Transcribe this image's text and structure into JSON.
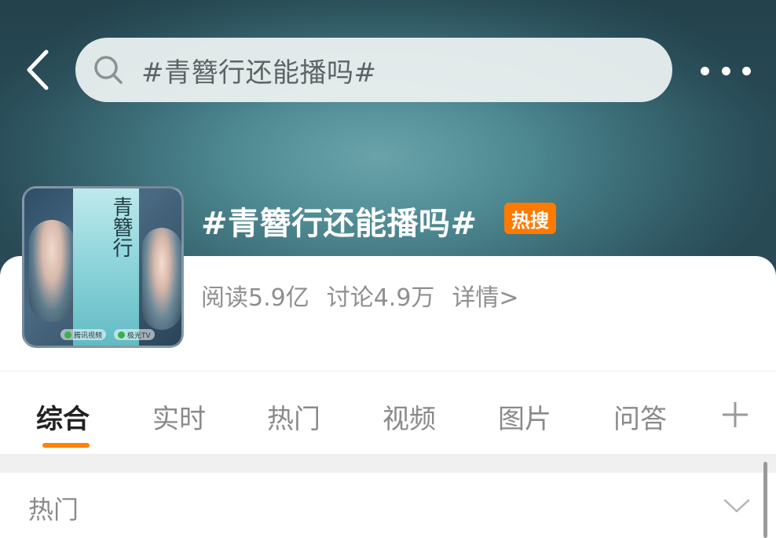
{
  "search": {
    "query": "#青簪行还能播吗#"
  },
  "topic": {
    "title": "#青簪行还能播吗#",
    "badge": "热搜",
    "stats": {
      "read": "阅读5.9亿",
      "discuss": "讨论4.9万",
      "details": "详情>"
    },
    "poster": {
      "title": "青簪行",
      "logos": [
        "腾讯视频",
        "极光TV"
      ]
    }
  },
  "tabs": [
    {
      "label": "综合",
      "active": true
    },
    {
      "label": "实时",
      "active": false
    },
    {
      "label": "热门",
      "active": false
    },
    {
      "label": "视频",
      "active": false
    },
    {
      "label": "图片",
      "active": false
    },
    {
      "label": "问答",
      "active": false
    }
  ],
  "section": {
    "label": "热门"
  },
  "colors": {
    "accent": "#ff8200",
    "hot_badge": "#ff7a00",
    "header_bg": "#4f8a93"
  },
  "icons": [
    "back-chevron-icon",
    "search-icon",
    "more-dots-icon",
    "plus-icon",
    "chevron-down-icon"
  ]
}
